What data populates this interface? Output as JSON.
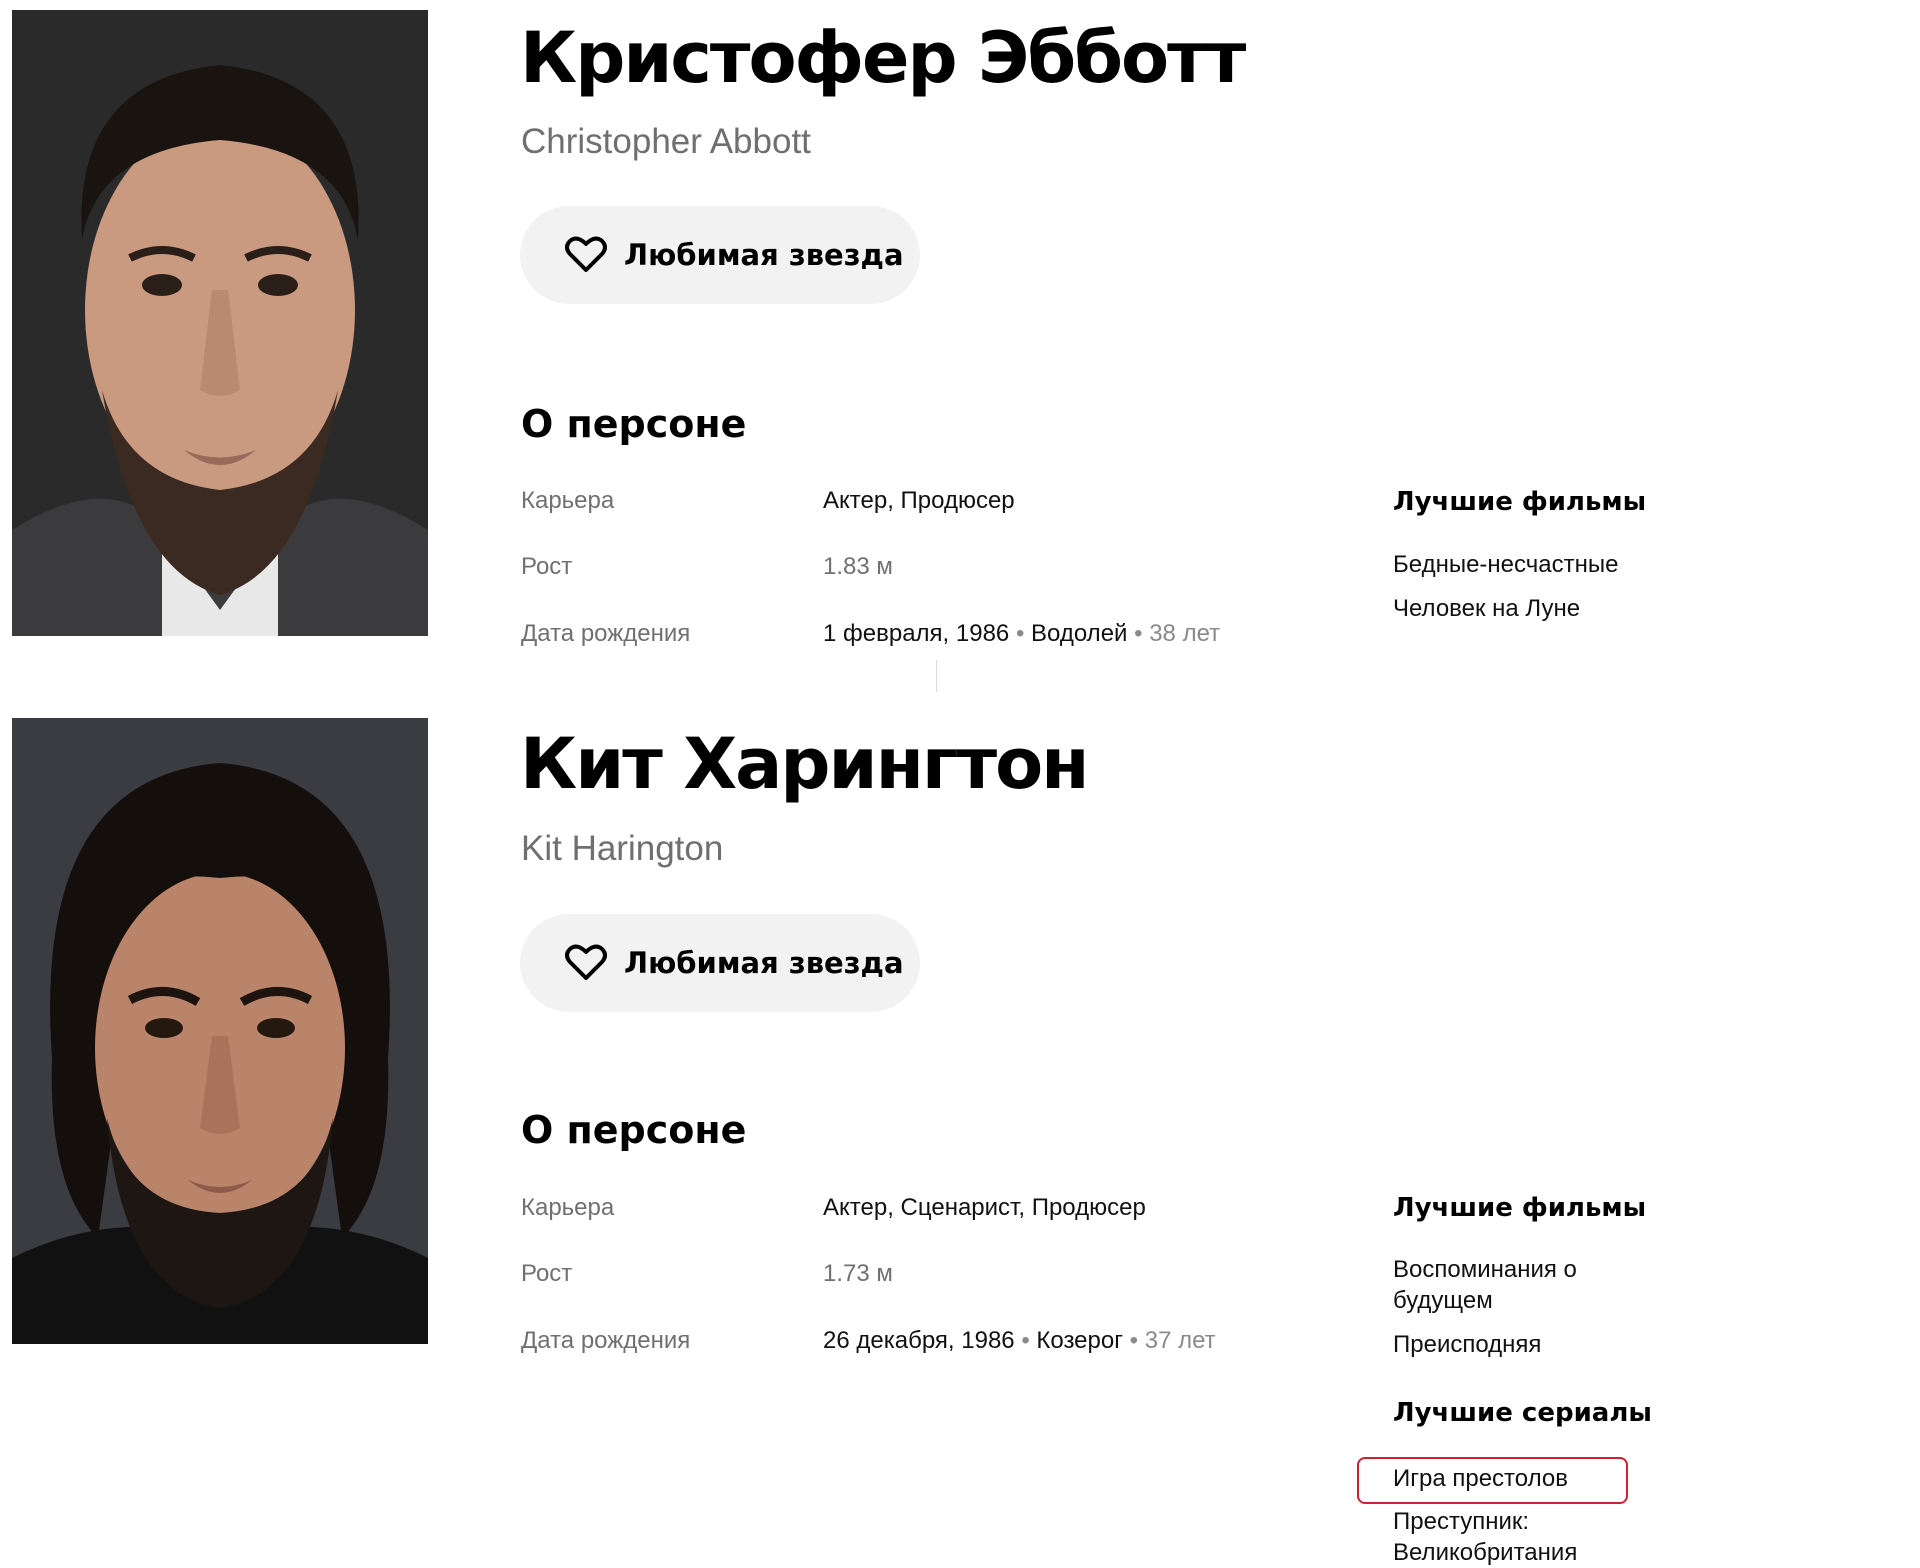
{
  "persons": [
    {
      "name_ru": "Кристофер Эбботт",
      "name_en": "Christopher Abbott",
      "favorite_button": "Любимая звезда",
      "section_title": "О персоне",
      "career_label": "Карьера",
      "career_value": "Актер, Продюсер",
      "height_label": "Рост",
      "height_value": "1.83 м",
      "birth_label": "Дата рождения",
      "birth_date": "1 февраля, 1986",
      "birth_sign": "Водолей",
      "birth_age": "38 лет",
      "best_films_title": "Лучшие фильмы",
      "best_films": [
        "Бедные-несчастные",
        "Человек на Луне"
      ]
    },
    {
      "name_ru": "Кит Харингтон",
      "name_en": "Kit Harington",
      "favorite_button": "Любимая звезда",
      "section_title": "О персоне",
      "career_label": "Карьера",
      "career_value": "Актер, Сценарист, Продюсер",
      "height_label": "Рост",
      "height_value": "1.73 м",
      "birth_label": "Дата рождения",
      "birth_date": "26 декабря, 1986",
      "birth_sign": "Козерог",
      "birth_age": "37 лет",
      "best_films_title": "Лучшие фильмы",
      "best_films": [
        "Воспоминания о будущем",
        "Преисподняя"
      ],
      "best_series_title": "Лучшие сериалы",
      "best_series": [
        "Игра престолов",
        "Преступник: Великобритания"
      ]
    }
  ],
  "colors": {
    "highlight_border": "#cc2233",
    "button_bg": "#f2f2f2",
    "muted_text": "#707070"
  },
  "icons": {
    "favorite": "heart-outline-icon"
  }
}
